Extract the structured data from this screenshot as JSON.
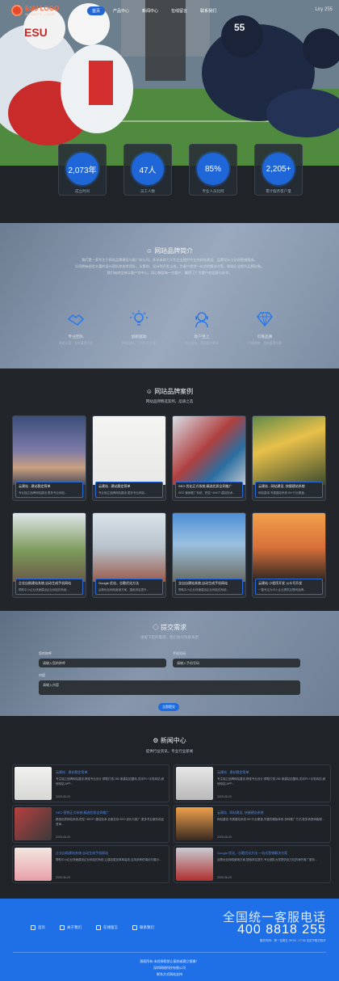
{
  "brand": {
    "name": "ESU LOGO",
    "sub": "WEBSITE LOGO"
  },
  "nav": {
    "items": [
      "首页",
      "产品中心",
      "新闻中心",
      "在线留言",
      "联系我们"
    ],
    "right": "Liry 255"
  },
  "stats": [
    {
      "value": "2,073年",
      "label": "成立时间"
    },
    {
      "value": "47人",
      "label": "员工人数"
    },
    {
      "value": "85%",
      "label": "专业人员比例"
    },
    {
      "value": "2,205+",
      "label": "累计服务客户量"
    }
  ],
  "about": {
    "title": "网站品牌简介",
    "paragraphs": [
      "我们是一家专注于网站品牌建设与推广的公司，多年来致力于为企业提供专业的网站建设、品牌设计与全网营销服务。",
      "公司拥有经验丰富的设计团队和技术团队，从策划、设计到开发上线，为客户提供一站式的解决方案，帮助企业提升品牌形象。",
      "我们始终坚持以客户为中心，用心服务每一位客户，赢得了广大客户的信赖与好评。"
    ],
    "features": [
      {
        "title": "专业团队",
        "desc": "经验丰富，技术精湛可靠"
      },
      {
        "title": "创新驱动",
        "desc": "持续创新，引领行业发展"
      },
      {
        "title": "客户至上",
        "desc": "用心服务，满足客户需求"
      },
      {
        "title": "可靠品质",
        "desc": "严格把控，品质值得信赖"
      }
    ]
  },
  "cases": {
    "title": "网站品牌案例",
    "subtitle": "网站品牌精选案例，品质之选",
    "items": [
      {
        "title": "云建站 - 建站稳定简单",
        "desc": "专业独立品牌网站建设,更多专业网站..."
      },
      {
        "title": "云建站 - 建站稳定简单",
        "desc": "专业独立品牌网站建设,更多专业网站..."
      },
      {
        "title": "SEO 优化正式系统,精选优质全网推广",
        "desc": "SEO 营销推广系统，把控 +8HOT 建站技术..."
      },
      {
        "title": "云建站 - 网站建设, 快捷建站系统",
        "desc": "网站建设,专属建站系统 80+行业覆盖..."
      },
      {
        "title": "企业自助建站系统,自动生成手机网站",
        "desc": "帮助中小企业快速建设企业网站的系统..."
      },
      {
        "title": "Google 优化，谷歌优化方法",
        "desc": "谷歌优化网络营销方案，搜索排名提升..."
      },
      {
        "title": "全自自建站系统,自动生成手机网站",
        "desc": "帮助中小企业快速建设企业网站的系统..."
      },
      {
        "title": "云建站 小程序开发 公众号开发",
        "desc": "一整专注为中小企业提供互联网品牌..."
      }
    ]
  },
  "form": {
    "title": "提交需求",
    "subtitle": "请留下您的需求，我们会尽快联系您",
    "name_label": "您的称呼",
    "name_placeholder": "请输入您的称呼",
    "phone_label": "手机号码",
    "phone_placeholder": "请输入手机号码",
    "content_label": "内容",
    "content_placeholder": "请输入内容",
    "submit": "立即提交"
  },
  "news": {
    "title": "新闻中心",
    "subtitle": "提供行业资讯，专业行业新闻",
    "items": [
      {
        "title": "云建站 - 建站稳定简单",
        "desc": "专注独立品牌网站建设,精准专业设计,帮助打造 280 家建站加盟商,支持PC+手机网站,微信网站,APP...",
        "date": "2025-06-29"
      },
      {
        "title": "云建站 - 建站稳定简单",
        "desc": "专注独立品牌网站建设,精准专业设计,帮助打造 280 家建站加盟商,支持PC+手机网站,微信网站,APP...",
        "date": "2025-06-29"
      },
      {
        "title": "SEO 营销正式系统,精选优质全网推广",
        "desc": "精选优质网站系统,把控 +8HOT 建站技术,全面支持 SEO 优化与推广,更多专业服务欢迎咨询...",
        "date": "2025-06-29"
      },
      {
        "title": "云建站 - 网站建设, 快捷建站系统",
        "desc": "网站建设,专属建站系统 80+行业覆盖,完善的模板体系,多种推广方式,更多请咨询客服...",
        "date": "2025-06-29"
      },
      {
        "title": "企业自助建站系统,自动生成手机网站",
        "desc": "帮助中小企业快速建设企业网站的系统,让建站更加简单高效,支持多种终端访问展示...",
        "date": "2025-06-29"
      },
      {
        "title": "Google 优化，谷歌优化方法 一站式营销解决方案",
        "desc": "谷歌优化网络营销方案,搜索排名提升,专业团队为您提供全方位的海外推广服务...",
        "date": "2025-06-29"
      }
    ]
  },
  "footer": {
    "links": [
      "首页",
      "关于我们",
      "在线留言",
      "联系我们"
    ],
    "hotline_title": "全国统一客服电话",
    "hotline": "400 8818 255",
    "hours": "服务时间：周一至周五 09:00 - 17:30 法定节假日除外",
    "copy": [
      "版权所有 未经授权禁止复制或建立镜像！",
      "深圳网络科技有限公司",
      "联系方式网站支持"
    ]
  }
}
